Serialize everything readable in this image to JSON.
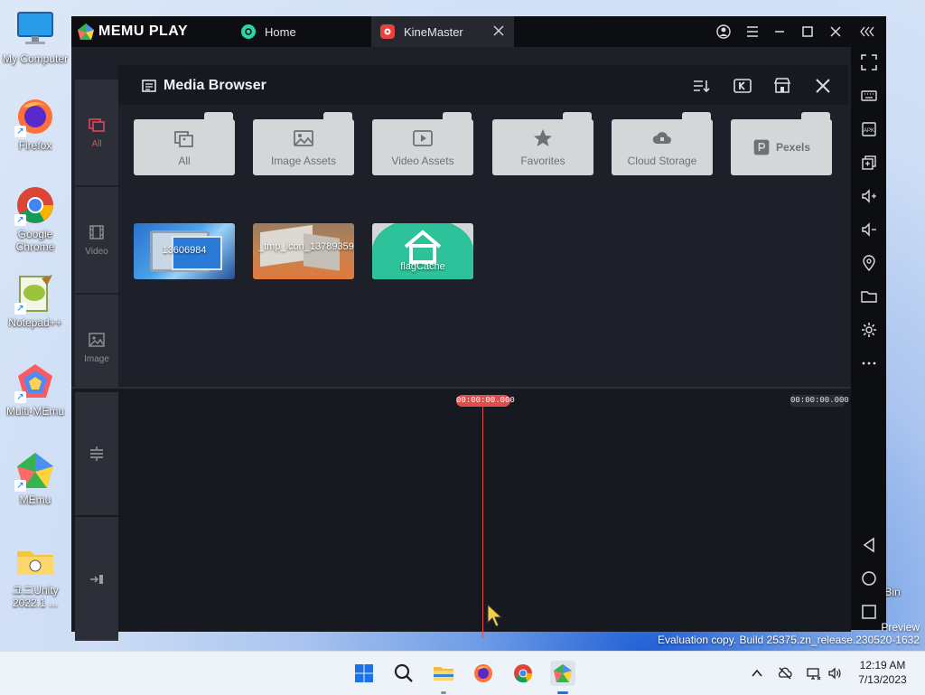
{
  "desktop": {
    "icons": [
      {
        "label": "My Computer"
      },
      {
        "label": "Firefox"
      },
      {
        "label": "Google Chrome"
      },
      {
        "label": "Notepad++"
      },
      {
        "label": "Multi-MEmu"
      },
      {
        "label": "MEmu"
      },
      {
        "label": "ユニUnity 2022.1 ..."
      }
    ],
    "recycle_bin_partial": "e Bin",
    "watermark_line1": "Preview",
    "watermark_line2": "Evaluation copy. Build 25375.zn_release.230520-1632"
  },
  "emulator": {
    "brand": "MEMU PLAY",
    "tabs": [
      {
        "label": "Home"
      },
      {
        "label": "KineMaster"
      }
    ]
  },
  "kinemaster": {
    "sidebar": [
      {
        "label": "All"
      },
      {
        "label": "Video"
      },
      {
        "label": "Image"
      }
    ],
    "media_browser_title": "Media Browser",
    "folders": [
      {
        "label": "All"
      },
      {
        "label": "Image Assets"
      },
      {
        "label": "Video Assets"
      },
      {
        "label": "Favorites"
      },
      {
        "label": "Cloud Storage"
      },
      {
        "label": "Pexels"
      }
    ],
    "media_items": [
      {
        "label": "13606984"
      },
      {
        "label": "_tmp_icon_13789359"
      },
      {
        "label": "flagCache"
      }
    ],
    "timeline": {
      "playhead_time": "00:00:00.000",
      "total_time": "00:00:00.000"
    }
  },
  "taskbar": {
    "time": "12:19 AM",
    "date": "7/13/2023"
  },
  "colors": {
    "accent_red": "#e24c4c",
    "kinemaster_bg": "#1d2029",
    "folder": "#d5d6d8"
  }
}
